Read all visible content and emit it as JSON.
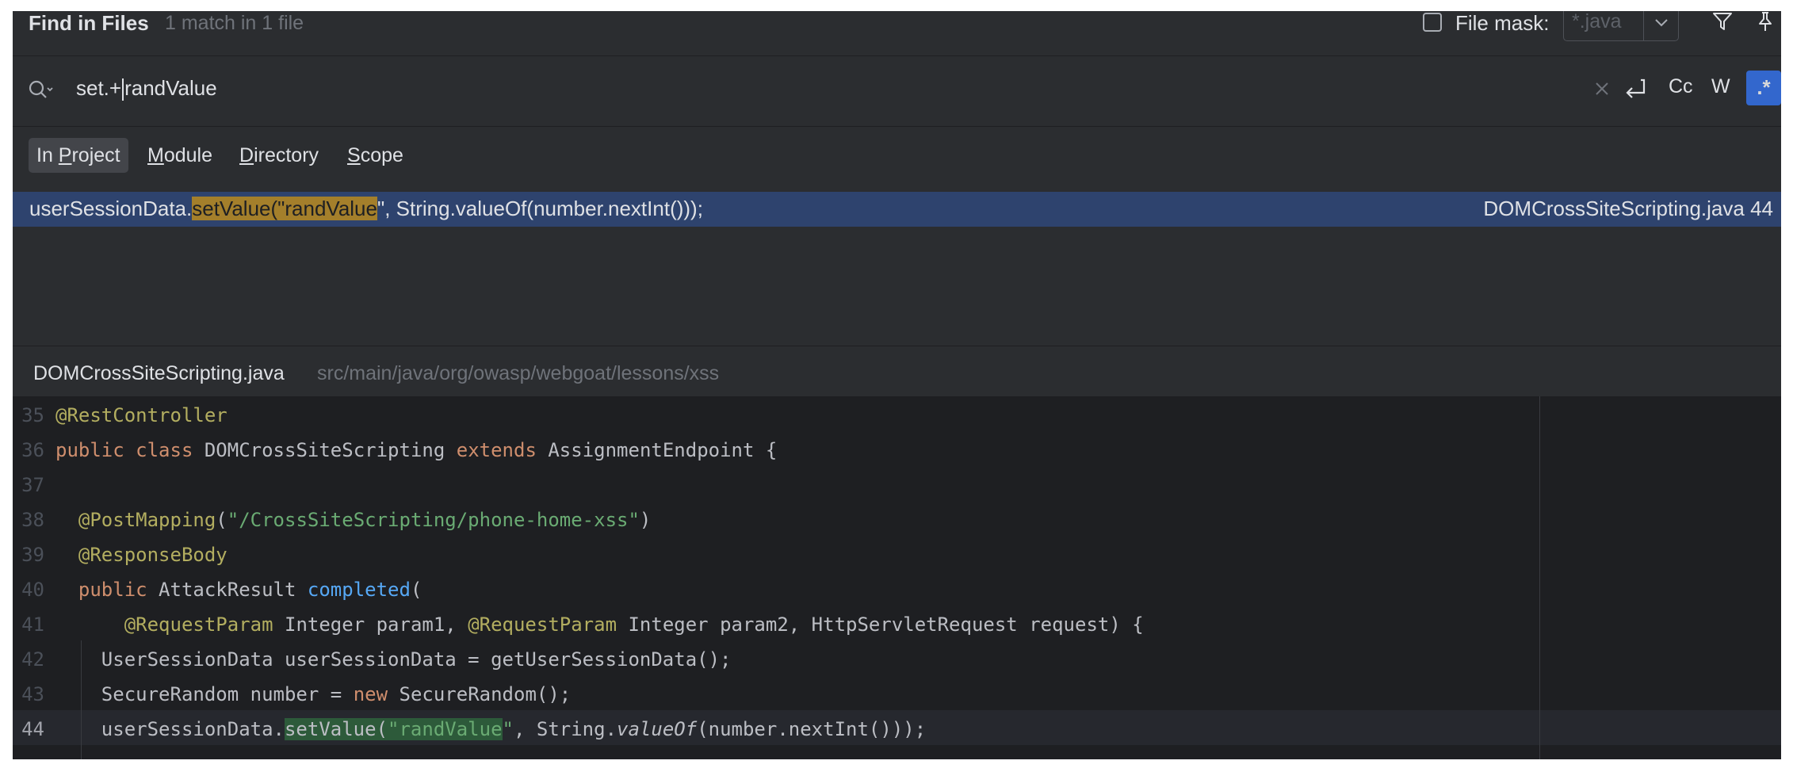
{
  "header": {
    "title": "Find in Files",
    "match_count": "1 match in 1 file",
    "file_mask_label": "File mask:",
    "file_mask_value": "*.java"
  },
  "search": {
    "query_before_caret": "set.+",
    "query_after_caret": "randValue",
    "match_case_label": "Cc",
    "words_label": "W",
    "regex_label": ".*"
  },
  "scopes": [
    {
      "label_pre": "In ",
      "mnemonic": "P",
      "label_post": "roject",
      "active": true
    },
    {
      "label_pre": "",
      "mnemonic": "M",
      "label_post": "odule",
      "active": false
    },
    {
      "label_pre": "",
      "mnemonic": "D",
      "label_post": "irectory",
      "active": false
    },
    {
      "label_pre": "",
      "mnemonic": "S",
      "label_post": "cope",
      "active": false
    }
  ],
  "results": [
    {
      "pre": "userSessionData.",
      "match": "setValue(\"randValue",
      "post": "\", String.valueOf(number.nextInt()));",
      "file": "DOMCrossSiteScripting.java",
      "line": "44"
    }
  ],
  "preview": {
    "file_name": "DOMCrossSiteScripting.java",
    "file_path": "src/main/java/org/owasp/webgoat/lessons/xss",
    "current_line": "44",
    "lines": [
      {
        "n": "35",
        "parts": [
          {
            "t": "@RestController",
            "c": "ann"
          }
        ]
      },
      {
        "n": "36",
        "parts": [
          {
            "t": "public",
            "c": "kw"
          },
          {
            "t": " "
          },
          {
            "t": "class",
            "c": "kw"
          },
          {
            "t": " DOMCrossSiteScripting "
          },
          {
            "t": "extends",
            "c": "kw"
          },
          {
            "t": " AssignmentEndpoint {"
          }
        ]
      },
      {
        "n": "37",
        "parts": []
      },
      {
        "n": "38",
        "parts": [
          {
            "t": "  "
          },
          {
            "t": "@PostMapping",
            "c": "ann"
          },
          {
            "t": "("
          },
          {
            "t": "\"/CrossSiteScripting/phone-home-xss\"",
            "c": "str"
          },
          {
            "t": ")"
          }
        ]
      },
      {
        "n": "39",
        "parts": [
          {
            "t": "  "
          },
          {
            "t": "@ResponseBody",
            "c": "ann"
          }
        ]
      },
      {
        "n": "40",
        "parts": [
          {
            "t": "  "
          },
          {
            "t": "public",
            "c": "kw"
          },
          {
            "t": " AttackResult "
          },
          {
            "t": "completed",
            "c": "fn"
          },
          {
            "t": "("
          }
        ]
      },
      {
        "n": "41",
        "parts": [
          {
            "t": "      "
          },
          {
            "t": "@RequestParam",
            "c": "ann"
          },
          {
            "t": " Integer param1, "
          },
          {
            "t": "@RequestParam",
            "c": "ann"
          },
          {
            "t": " Integer param2, HttpServletRequest request) {"
          }
        ]
      },
      {
        "n": "42",
        "parts": [
          {
            "t": "    UserSessionData userSessionData = getUserSessionData();"
          }
        ]
      },
      {
        "n": "43",
        "parts": [
          {
            "t": "    SecureRandom number = "
          },
          {
            "t": "new",
            "c": "kw"
          },
          {
            "t": " SecureRandom();"
          }
        ]
      },
      {
        "n": "44",
        "parts": [
          {
            "t": "    userSessionData."
          },
          {
            "t": "setValue(",
            "c": "mhl"
          },
          {
            "t": "\"randValue",
            "c": "str mhl"
          },
          {
            "t": "\"",
            "c": "str"
          },
          {
            "t": ", String."
          },
          {
            "t": "valueOf",
            "c": "it"
          },
          {
            "t": "(number.nextInt()));"
          }
        ]
      }
    ]
  }
}
